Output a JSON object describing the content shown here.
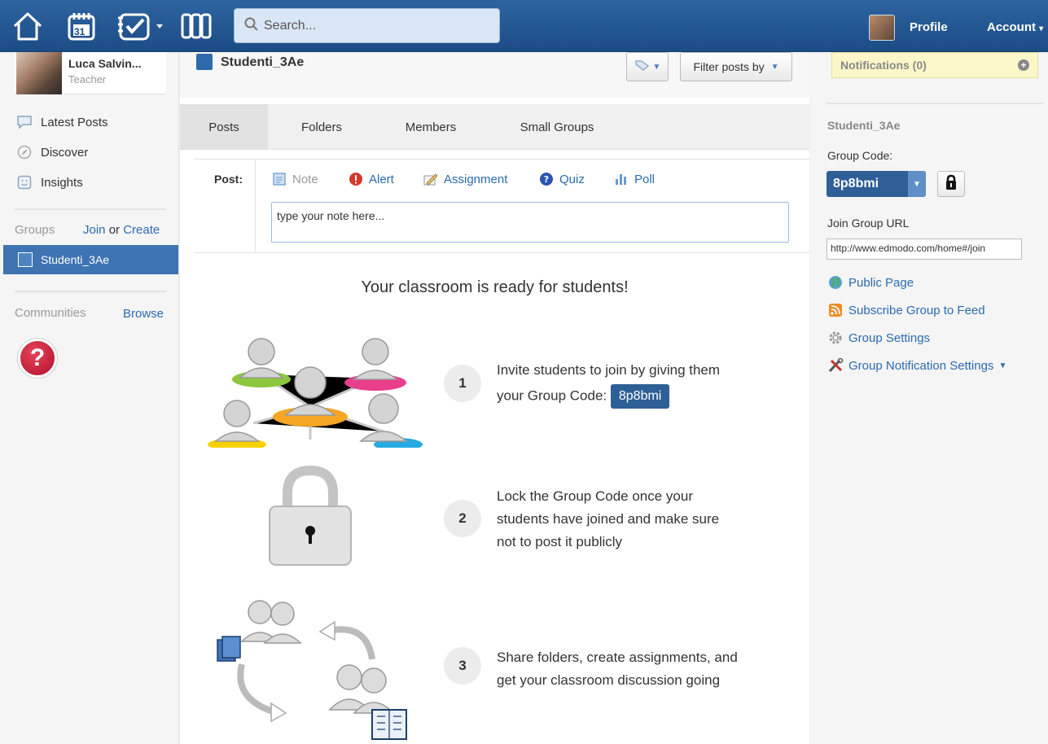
{
  "topnav": {
    "search_placeholder": "Search...",
    "calendar_day": "31",
    "profile_label": "Profile",
    "account_label": "Account"
  },
  "user": {
    "name": "Luca Salvin...",
    "role": "Teacher"
  },
  "sidebar": {
    "items": [
      {
        "label": "Latest Posts",
        "icon": "speech-bubble-icon"
      },
      {
        "label": "Discover",
        "icon": "compass-icon"
      },
      {
        "label": "Insights",
        "icon": "insights-icon"
      }
    ],
    "groups_heading": "Groups",
    "join_label": "Join",
    "or_label": "or",
    "create_label": "Create",
    "selected_group": "Studenti_3Ae",
    "communities_heading": "Communities",
    "browse_label": "Browse",
    "help_glyph": "?"
  },
  "group": {
    "title": "Studenti_3Ae",
    "filter_label": "Filter posts by"
  },
  "tabs": [
    {
      "label": "Posts",
      "active": true
    },
    {
      "label": "Folders",
      "active": false
    },
    {
      "label": "Members",
      "active": false
    },
    {
      "label": "Small Groups",
      "active": false
    }
  ],
  "post": {
    "label": "Post:",
    "types": [
      "Note",
      "Alert",
      "Assignment",
      "Quiz",
      "Poll"
    ],
    "input_value": "type your note here..."
  },
  "onboarding": {
    "title": "Your classroom is ready for students!",
    "steps": [
      {
        "num": "1",
        "line1": "Invite students to join by giving them",
        "line2_prefix": "your Group Code:",
        "code": "8p8bmi"
      },
      {
        "num": "2",
        "line1": "Lock the Group Code once your",
        "line2": "students have joined and make sure",
        "line3": "not to post it publicly"
      },
      {
        "num": "3",
        "line1": "Share folders, create assignments, and",
        "line2": "get your classroom discussion going"
      }
    ]
  },
  "right": {
    "notifications": "Notifications (0)",
    "group_name": "Studenti_3Ae",
    "group_code_label": "Group Code:",
    "group_code": "8p8bmi",
    "join_url_label": "Join Group URL",
    "join_url": "http://www.edmodo.com/home#/join",
    "links": [
      "Public Page",
      "Subscribe Group to Feed",
      "Group Settings",
      "Group Notification Settings"
    ]
  },
  "colors": {
    "nav_blue": "#1f5490",
    "accent_blue": "#2e5f96",
    "link_blue": "#2a6bb0",
    "notif_yellow": "#fbf7c9"
  }
}
